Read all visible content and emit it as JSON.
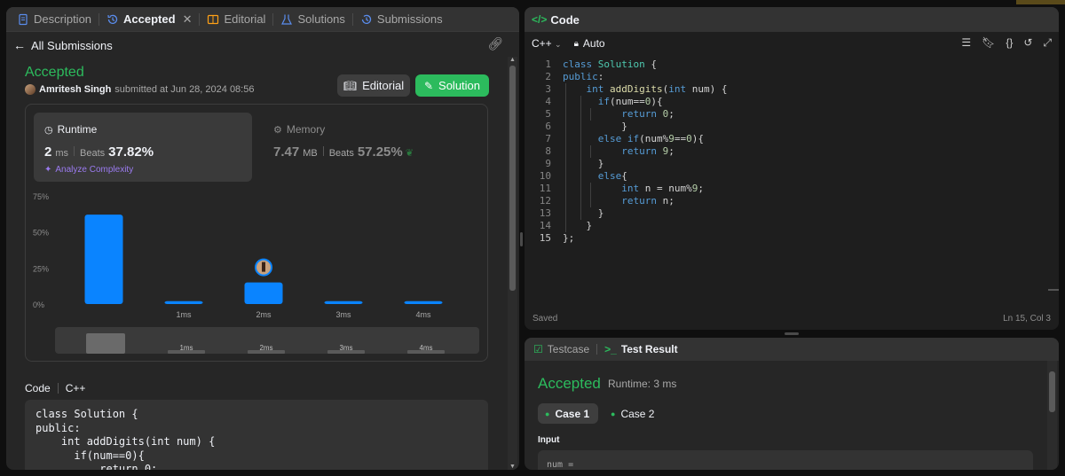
{
  "tabs": [
    {
      "label": "Description"
    },
    {
      "label": "Accepted"
    },
    {
      "label": "Editorial"
    },
    {
      "label": "Solutions"
    },
    {
      "label": "Submissions"
    }
  ],
  "back_link": "All Submissions",
  "submission": {
    "status": "Accepted",
    "author": "Amritesh Singh",
    "submitted_text": "submitted at Jun 28, 2024 08:56",
    "editorial_btn": "Editorial",
    "solution_btn": "Solution"
  },
  "runtime": {
    "label": "Runtime",
    "value": "2",
    "unit": "ms",
    "beats_label": "Beats",
    "beats_pct": "37.82%",
    "analyze": "Analyze Complexity"
  },
  "memory": {
    "label": "Memory",
    "value": "7.47",
    "unit": "MB",
    "beats_label": "Beats",
    "beats_pct": "57.25%"
  },
  "chart_data": {
    "type": "bar",
    "categories": [
      "",
      "1ms",
      "2ms",
      "3ms",
      "4ms"
    ],
    "values": [
      62,
      2,
      15,
      2,
      2
    ],
    "ylim": [
      0,
      75
    ],
    "yticks": [
      "75%",
      "50%",
      "25%",
      "0%"
    ],
    "highlight_category": "2ms",
    "bar_color": "#0a84ff",
    "range_labels": [
      "1ms",
      "2ms",
      "3ms",
      "4ms"
    ]
  },
  "code_section": {
    "label": "Code",
    "lang": "C++",
    "preview": "class Solution {\npublic:\n    int addDigits(int num) {\n      if(num==0){\n          return 0;"
  },
  "editor": {
    "title": "Code",
    "language": "C++",
    "mode": "Auto",
    "saved": "Saved",
    "cursor": "Ln 15, Col 3",
    "line_numbers": [
      "1",
      "2",
      "3",
      "4",
      "5",
      "6",
      "7",
      "8",
      "9",
      "10",
      "11",
      "12",
      "13",
      "14",
      "15"
    ]
  },
  "result": {
    "tab_testcase": "Testcase",
    "tab_result": "Test Result",
    "status": "Accepted",
    "runtime": "Runtime: 3 ms",
    "case1": "Case 1",
    "case2": "Case 2",
    "input_label": "Input",
    "input_value": "num ="
  },
  "colors": {
    "accent_green": "#2cbb5d",
    "bar_blue": "#0a84ff",
    "purple": "#9b7bf0"
  }
}
